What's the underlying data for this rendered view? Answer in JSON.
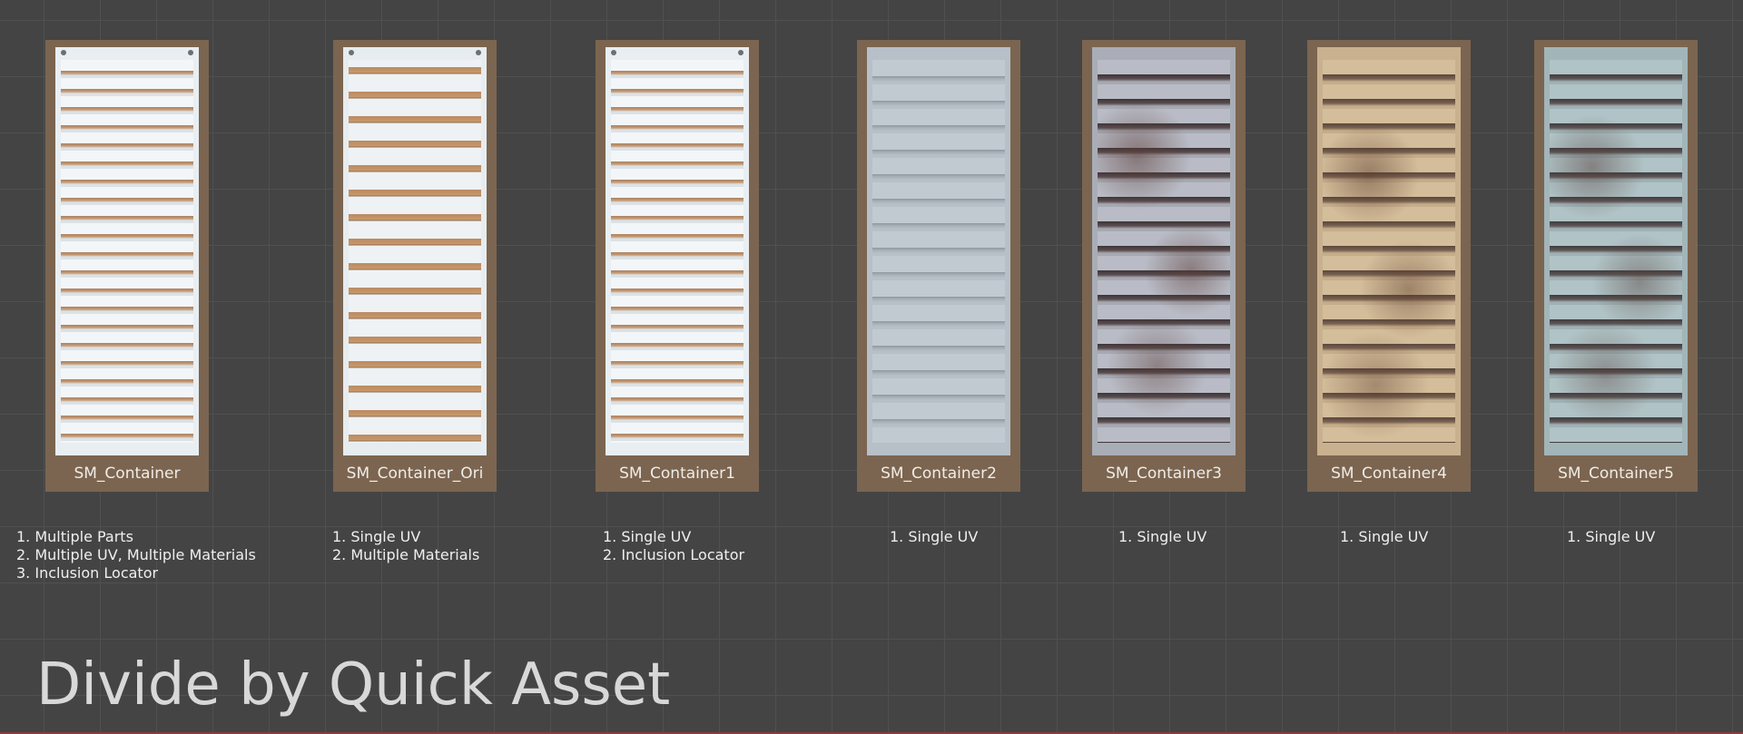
{
  "assets": [
    {
      "label": "SM_Container",
      "notes": [
        "1. Multiple Parts",
        "2. Multiple UV, Multiple Materials",
        "3. Inclusion Locator"
      ]
    },
    {
      "label": "SM_Container_Ori",
      "notes": [
        "1. Single UV",
        "2. Multiple Materials"
      ]
    },
    {
      "label": "SM_Container1",
      "notes": [
        "1. Single UV",
        "2. Inclusion Locator"
      ]
    },
    {
      "label": "SM_Container2",
      "notes": [
        "1. Single UV"
      ]
    },
    {
      "label": "SM_Container3",
      "notes": [
        "1. Single UV"
      ]
    },
    {
      "label": "SM_Container4",
      "notes": [
        "1. Single UV"
      ]
    },
    {
      "label": "SM_Container5",
      "notes": [
        "1. Single UV"
      ]
    }
  ],
  "title": "Divide by Quick Asset",
  "colors": {
    "background": "#444444",
    "card": "#7b6550",
    "label_text": "#f0ece6"
  }
}
